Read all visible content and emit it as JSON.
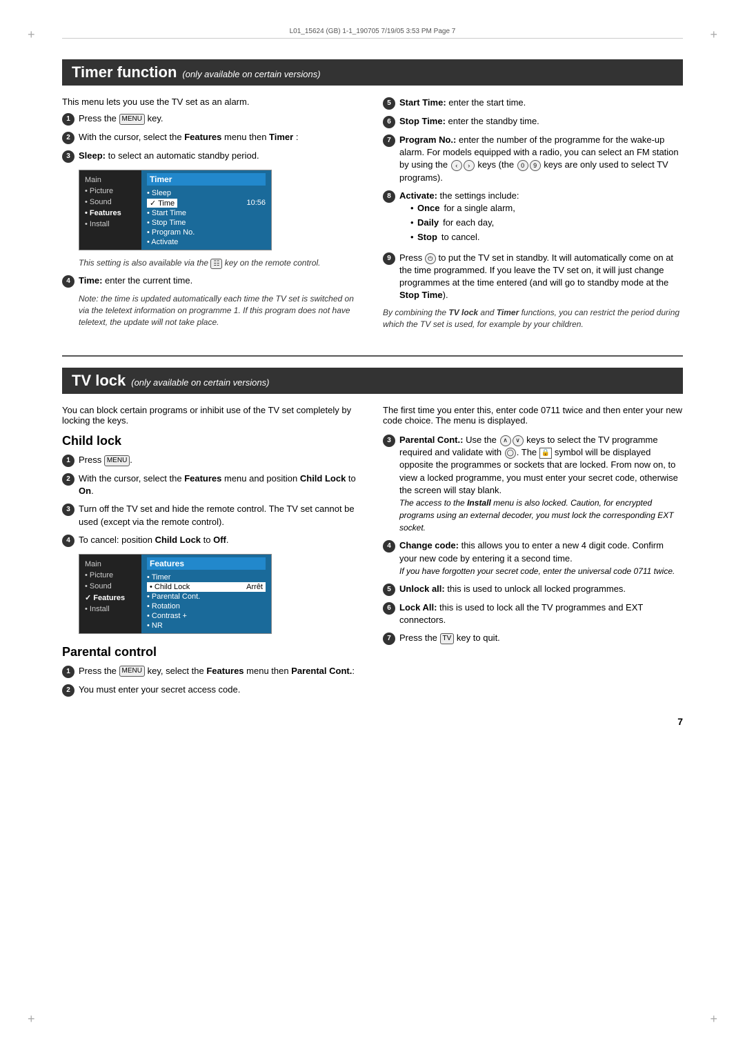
{
  "meta": {
    "line": "L01_15624 (GB) 1-1_190705  7/19/05  3:53 PM  Page 7"
  },
  "timer_section": {
    "title": "Timer function",
    "subtitle": "(only available on certain versions)",
    "intro": "This menu lets you use the TV set as an alarm.",
    "steps_left": [
      {
        "num": "1",
        "text": "Press the ",
        "key": "MENU",
        "text2": " key."
      },
      {
        "num": "2",
        "text": "With the cursor, select the ",
        "bold": "Features",
        "text2": " menu then ",
        "bold2": "Timer",
        "text3": " :"
      },
      {
        "num": "3",
        "bold": "Sleep:",
        "text": " to select an automatic standby period."
      }
    ],
    "menu": {
      "left_items": [
        "Main",
        "• Picture",
        "• Sound",
        "• Features",
        "• Install"
      ],
      "active_left": "• Features",
      "title": "Timer",
      "items": [
        "• Sleep",
        "✓ Time",
        "• Start Time",
        "• Stop Time",
        "• Program No.",
        "• Activate"
      ],
      "highlighted": "✓ Time",
      "time_value": "10:56"
    },
    "setting_note": "This setting is also available via the",
    "setting_note2": "key on the remote control.",
    "steps_left2": [
      {
        "num": "4",
        "bold": "Time:",
        "text": " enter the current time."
      },
      {
        "italic": "Note: the time is updated automatically each time the TV set is switched on via the teletext information on programme 1. If this program does not have teletext, the update will not take place."
      }
    ],
    "steps_right": [
      {
        "num": "5",
        "bold": "Start Time:",
        "text": " enter the start time."
      },
      {
        "num": "6",
        "bold": "Stop Time:",
        "text": " enter the standby time."
      },
      {
        "num": "7",
        "bold": "Program No.:",
        "text": " enter the number of the programme for the wake-up alarm. For models equipped with a radio, you can select an FM station by using the",
        "text2": " keys (the ",
        "keys2": "0)(9",
        "text3": " keys are only used to select TV programs)."
      },
      {
        "num": "8",
        "bold": "Activate:",
        "text": " the settings include:",
        "bullets": [
          "Once for a single alarm,",
          "Daily for each day,",
          "Stop to cancel."
        ]
      },
      {
        "num": "9",
        "text": "Press ",
        "key": "power",
        "text2": " to put the TV set in standby. It will automatically come on at the time programmed. If you leave the TV set on, it will just change programmes at the time entered (and will go to standby mode at the ",
        "bold": "Stop Time",
        "text3": ")."
      },
      {
        "italic": "By combining the TV lock and Timer functions, you can restrict the period during which the TV set is used, for example by your children."
      }
    ]
  },
  "tvlock_section": {
    "title": "TV lock",
    "subtitle": "(only available on certain versions)",
    "intro": "You can block certain programs or inhibit use of the TV set completely by locking the keys.",
    "first_time": "The first time you enter this, enter code 0711 twice and then enter your new code choice. The menu is displayed.",
    "child_lock": {
      "title": "Child lock",
      "steps": [
        {
          "num": "1",
          "text": "Press ",
          "key": "MENU",
          "text2": "."
        },
        {
          "num": "2",
          "text": "With the cursor, select the ",
          "bold": "Features",
          "text2": " menu and position ",
          "bold2": "Child Lock",
          "text3": " to ",
          "bold3": "On",
          "text4": "."
        },
        {
          "num": "3",
          "text": "Turn off the TV set and hide the remote control. The TV set cannot be used (except via the remote control)."
        },
        {
          "num": "4",
          "text": "To cancel: position ",
          "bold": "Child Lock",
          "text2": " to ",
          "bold2": "Off",
          "text3": "."
        }
      ],
      "menu": {
        "left_items": [
          "Main",
          "• Picture",
          "• Sound",
          "✓ Features",
          "• Install"
        ],
        "active_left": "✓ Features",
        "title": "Features",
        "items": [
          "• Timer",
          "• Child Lock",
          "• Parental Cont.",
          "• Rotation",
          "• Contrast +",
          "• NR"
        ],
        "highlighted": "• Child Lock",
        "highlighted_value": "Arrêt"
      }
    },
    "parental_control": {
      "title": "Parental control",
      "steps": [
        {
          "num": "1",
          "text": "Press the ",
          "key": "MENU",
          "text2": " key, select the ",
          "bold": "Features",
          "text3": " menu then ",
          "bold2": "Parental Cont.",
          "text4": ":"
        },
        {
          "num": "2",
          "text": "You must enter your secret access code."
        }
      ]
    },
    "steps_right": [
      {
        "num": "3",
        "bold": "Parental Cont.:",
        "text": " Use the",
        "keys": "▲▼",
        "text2": " keys to select the TV programme required and validate with",
        "key": "OK",
        "text3": ". The ",
        "icon": "lock",
        "text4": " symbol will be displayed opposite the programmes or sockets that are locked. From now on, to view a locked programme, you must enter your secret code, otherwise the screen will stay blank.",
        "italic": "The access to the Install menu is also locked. Caution, for encrypted programs using an external decoder, you must lock the corresponding EXT socket."
      },
      {
        "num": "4",
        "bold": "Change code:",
        "text": " this allows you to enter a new 4 digit code. Confirm your new code by entering it a second time.",
        "italic": "If you have forgotten your secret code, enter the universal code 0711 twice."
      },
      {
        "num": "5",
        "bold": "Unlock all:",
        "text": " this is used to unlock all locked programmes."
      },
      {
        "num": "6",
        "bold": "Lock All:",
        "text": " this is used to lock all the TV programmes and EXT connectors."
      },
      {
        "num": "7",
        "text": "Press the ",
        "key": "TV",
        "text2": " key to quit."
      }
    ]
  },
  "page_number": "7"
}
